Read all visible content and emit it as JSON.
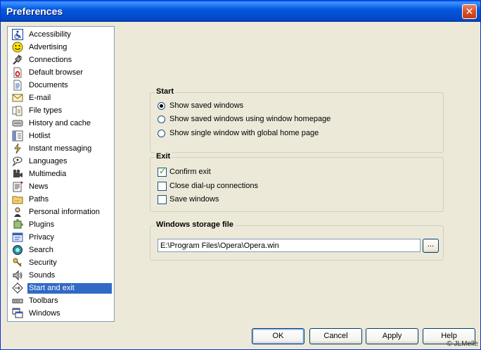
{
  "window": {
    "title": "Preferences"
  },
  "sidebar": {
    "selected_index": 20,
    "items": [
      {
        "label": "Accessibility",
        "icon": "wheelchair-icon"
      },
      {
        "label": "Advertising",
        "icon": "smiley-icon"
      },
      {
        "label": "Connections",
        "icon": "plug-icon"
      },
      {
        "label": "Default browser",
        "icon": "opera-doc-icon"
      },
      {
        "label": "Documents",
        "icon": "document-icon"
      },
      {
        "label": "E-mail",
        "icon": "envelope-icon"
      },
      {
        "label": "File types",
        "icon": "file-types-icon"
      },
      {
        "label": "History and cache",
        "icon": "history-icon"
      },
      {
        "label": "Hotlist",
        "icon": "hotlist-icon"
      },
      {
        "label": "Instant messaging",
        "icon": "messaging-icon"
      },
      {
        "label": "Languages",
        "icon": "languages-icon"
      },
      {
        "label": "Multimedia",
        "icon": "multimedia-icon"
      },
      {
        "label": "News",
        "icon": "news-icon"
      },
      {
        "label": "Paths",
        "icon": "folder-icon"
      },
      {
        "label": "Personal information",
        "icon": "person-icon"
      },
      {
        "label": "Plugins",
        "icon": "plugin-icon"
      },
      {
        "label": "Privacy",
        "icon": "privacy-icon"
      },
      {
        "label": "Search",
        "icon": "search-icon"
      },
      {
        "label": "Security",
        "icon": "keys-icon"
      },
      {
        "label": "Sounds",
        "icon": "speaker-icon"
      },
      {
        "label": "Start and exit",
        "icon": "start-exit-icon"
      },
      {
        "label": "Toolbars",
        "icon": "toolbar-icon"
      },
      {
        "label": "Windows",
        "icon": "windows-icon"
      }
    ]
  },
  "start_group": {
    "legend": "Start",
    "options": [
      {
        "label": "Show saved windows",
        "selected": true
      },
      {
        "label": "Show saved windows using window homepage",
        "selected": false
      },
      {
        "label": "Show single window with global home page",
        "selected": false
      }
    ]
  },
  "exit_group": {
    "legend": "Exit",
    "options": [
      {
        "label": "Confirm exit",
        "checked": true
      },
      {
        "label": "Close dial-up connections",
        "checked": false
      },
      {
        "label": "Save windows",
        "checked": false
      }
    ]
  },
  "storage_group": {
    "legend": "Windows storage file",
    "path_value": "E:\\Program Files\\Opera\\Opera.win",
    "browse_label": "..."
  },
  "buttons": {
    "ok": "OK",
    "cancel": "Cancel",
    "apply": "Apply",
    "help": "Help"
  },
  "copyright": "© JLMelle",
  "colors": {
    "selection": "#316ac5",
    "title_bar": "#0458e0",
    "dialog_bg": "#ece9d8"
  }
}
